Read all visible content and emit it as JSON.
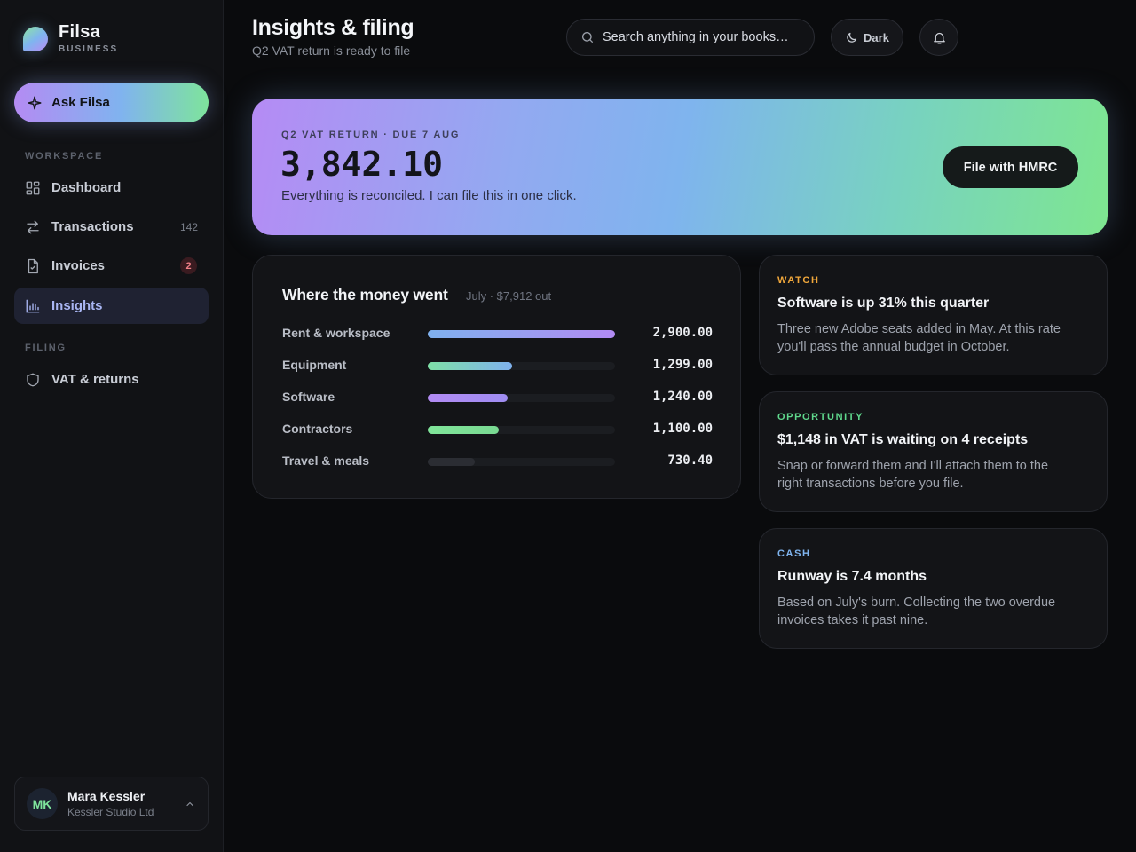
{
  "brand": {
    "name": "Filsa",
    "sub": "BUSINESS"
  },
  "sidebar": {
    "ask_label": "Ask Filsa",
    "workspace_label": "WORKSPACE",
    "filing_label": "FILING",
    "items": [
      {
        "label": "Dashboard"
      },
      {
        "label": "Transactions",
        "count": "142"
      },
      {
        "label": "Invoices",
        "badge": "2"
      },
      {
        "label": "Insights",
        "active": true
      },
      {
        "label": "VAT & returns"
      }
    ]
  },
  "user": {
    "initials": "MK",
    "name": "Mara Kessler",
    "org": "Kessler Studio Ltd"
  },
  "header": {
    "title": "Insights & filing",
    "subtitle": "Q2 VAT return is ready to file",
    "search_placeholder": "Search anything in your books…",
    "theme_label": "Dark"
  },
  "hero": {
    "label": "Q2 VAT RETURN · DUE 7 AUG",
    "amount": "3,842.10",
    "description": "Everything is reconciled. I can file this in one click.",
    "button_label": "File with HMRC"
  },
  "spending": {
    "title": "Where the money went",
    "meta": "July · $7,912 out",
    "rows": [
      {
        "label": "Rent & workspace",
        "value": "2,900.00",
        "amount": 2900,
        "color_from": "#7fb1ee",
        "color_to": "#b28bf3"
      },
      {
        "label": "Equipment",
        "value": "1,299.00",
        "amount": 1299,
        "color_from": "#7ee0a6",
        "color_to": "#7fb1ee"
      },
      {
        "label": "Software",
        "value": "1,240.00",
        "amount": 1240,
        "color_from": "#b28bf3",
        "color_to": "#9f8df2"
      },
      {
        "label": "Contractors",
        "value": "1,100.00",
        "amount": 1100,
        "color_from": "#80e59a",
        "color_to": "#79d992"
      },
      {
        "label": "Travel & meals",
        "value": "730.40",
        "amount": 730.4,
        "color_from": "#2b2d33",
        "color_to": "#2b2d33"
      }
    ]
  },
  "insights": [
    {
      "tag": "WATCH",
      "tag_color": "#f0a73b",
      "title": "Software is up 31% this quarter",
      "body": "Three new Adobe seats added in May. At this rate you'll pass the annual budget in October."
    },
    {
      "tag": "OPPORTUNITY",
      "tag_color": "#5fd88c",
      "title": "$1,148 in VAT is waiting on 4 receipts",
      "body": "Snap or forward them and I'll attach them to the right transactions before you file."
    },
    {
      "tag": "CASH",
      "tag_color": "#7fb4ee",
      "title": "Runway is 7.4 months",
      "body": "Based on July's burn. Collecting the two overdue invoices takes it past nine."
    }
  ]
}
